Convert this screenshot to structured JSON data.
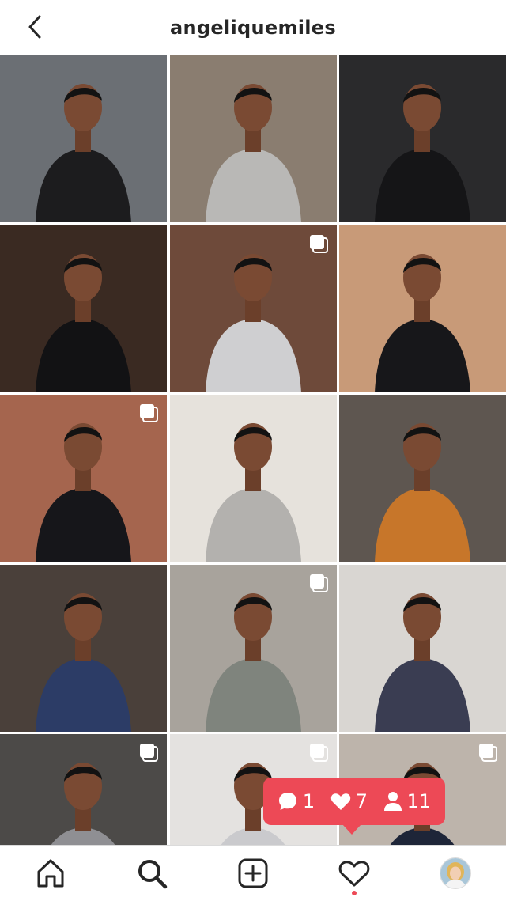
{
  "header": {
    "title": "angeliquemiles",
    "back_icon": "chevron-left-icon"
  },
  "grid": {
    "posts": [
      {
        "name": "post-street-crosswalk",
        "multiple": false,
        "bg": "#6b6f74",
        "accent": "#1c1c1e"
      },
      {
        "name": "post-laptop-coffee",
        "multiple": false,
        "bg": "#8a7d70",
        "accent": "#b9b8b6"
      },
      {
        "name": "post-dark-wall-leggings",
        "multiple": false,
        "bg": "#2a2a2c",
        "accent": "#151517"
      },
      {
        "name": "post-black-jacket-restaurant",
        "multiple": false,
        "bg": "#3a2a22",
        "accent": "#121214"
      },
      {
        "name": "post-grey-crop-stairs",
        "multiple": true,
        "bg": "#6e4a3a",
        "accent": "#cfcfd1"
      },
      {
        "name": "post-black-bodysuit",
        "multiple": false,
        "bg": "#c89a78",
        "accent": "#17171a"
      },
      {
        "name": "post-black-top-brick",
        "multiple": true,
        "bg": "#a5654e",
        "accent": "#16161a"
      },
      {
        "name": "post-grey-sweater-set",
        "multiple": false,
        "bg": "#e6e2dc",
        "accent": "#b3b1ae"
      },
      {
        "name": "post-orange-sports-bra",
        "multiple": false,
        "bg": "#5e5650",
        "accent": "#c7762a"
      },
      {
        "name": "post-navy-tank-portrait",
        "multiple": false,
        "bg": "#4a403a",
        "accent": "#2c3c66"
      },
      {
        "name": "post-grey-sports-bra-selfie",
        "multiple": true,
        "bg": "#a8a39c",
        "accent": "#7f847d"
      },
      {
        "name": "post-navy-cutout-top",
        "multiple": false,
        "bg": "#d9d6d2",
        "accent": "#3a3d52"
      },
      {
        "name": "post-grey-knit-portrait",
        "multiple": true,
        "bg": "#4c4a48",
        "accent": "#8f8f93"
      },
      {
        "name": "post-grey-hoodie-dress",
        "multiple": true,
        "bg": "#e4e2e0",
        "accent": "#cacacd"
      },
      {
        "name": "post-navy-sports-bra",
        "multiple": true,
        "bg": "#bdb4ab",
        "accent": "#1e2538"
      }
    ]
  },
  "activity": {
    "comments_count": "1",
    "likes_count": "7",
    "follows_count": "11",
    "comment_icon": "comment-bubble-icon",
    "like_icon": "heart-icon",
    "follow_icon": "person-icon",
    "color": "#ed4956"
  },
  "tabbar": {
    "items": [
      {
        "name": "home-tab",
        "icon": "home-icon"
      },
      {
        "name": "search-tab",
        "icon": "search-icon"
      },
      {
        "name": "create-tab",
        "icon": "plus-square-icon"
      },
      {
        "name": "activity-tab",
        "icon": "heart-icon"
      },
      {
        "name": "profile-tab",
        "icon": "avatar"
      }
    ]
  }
}
